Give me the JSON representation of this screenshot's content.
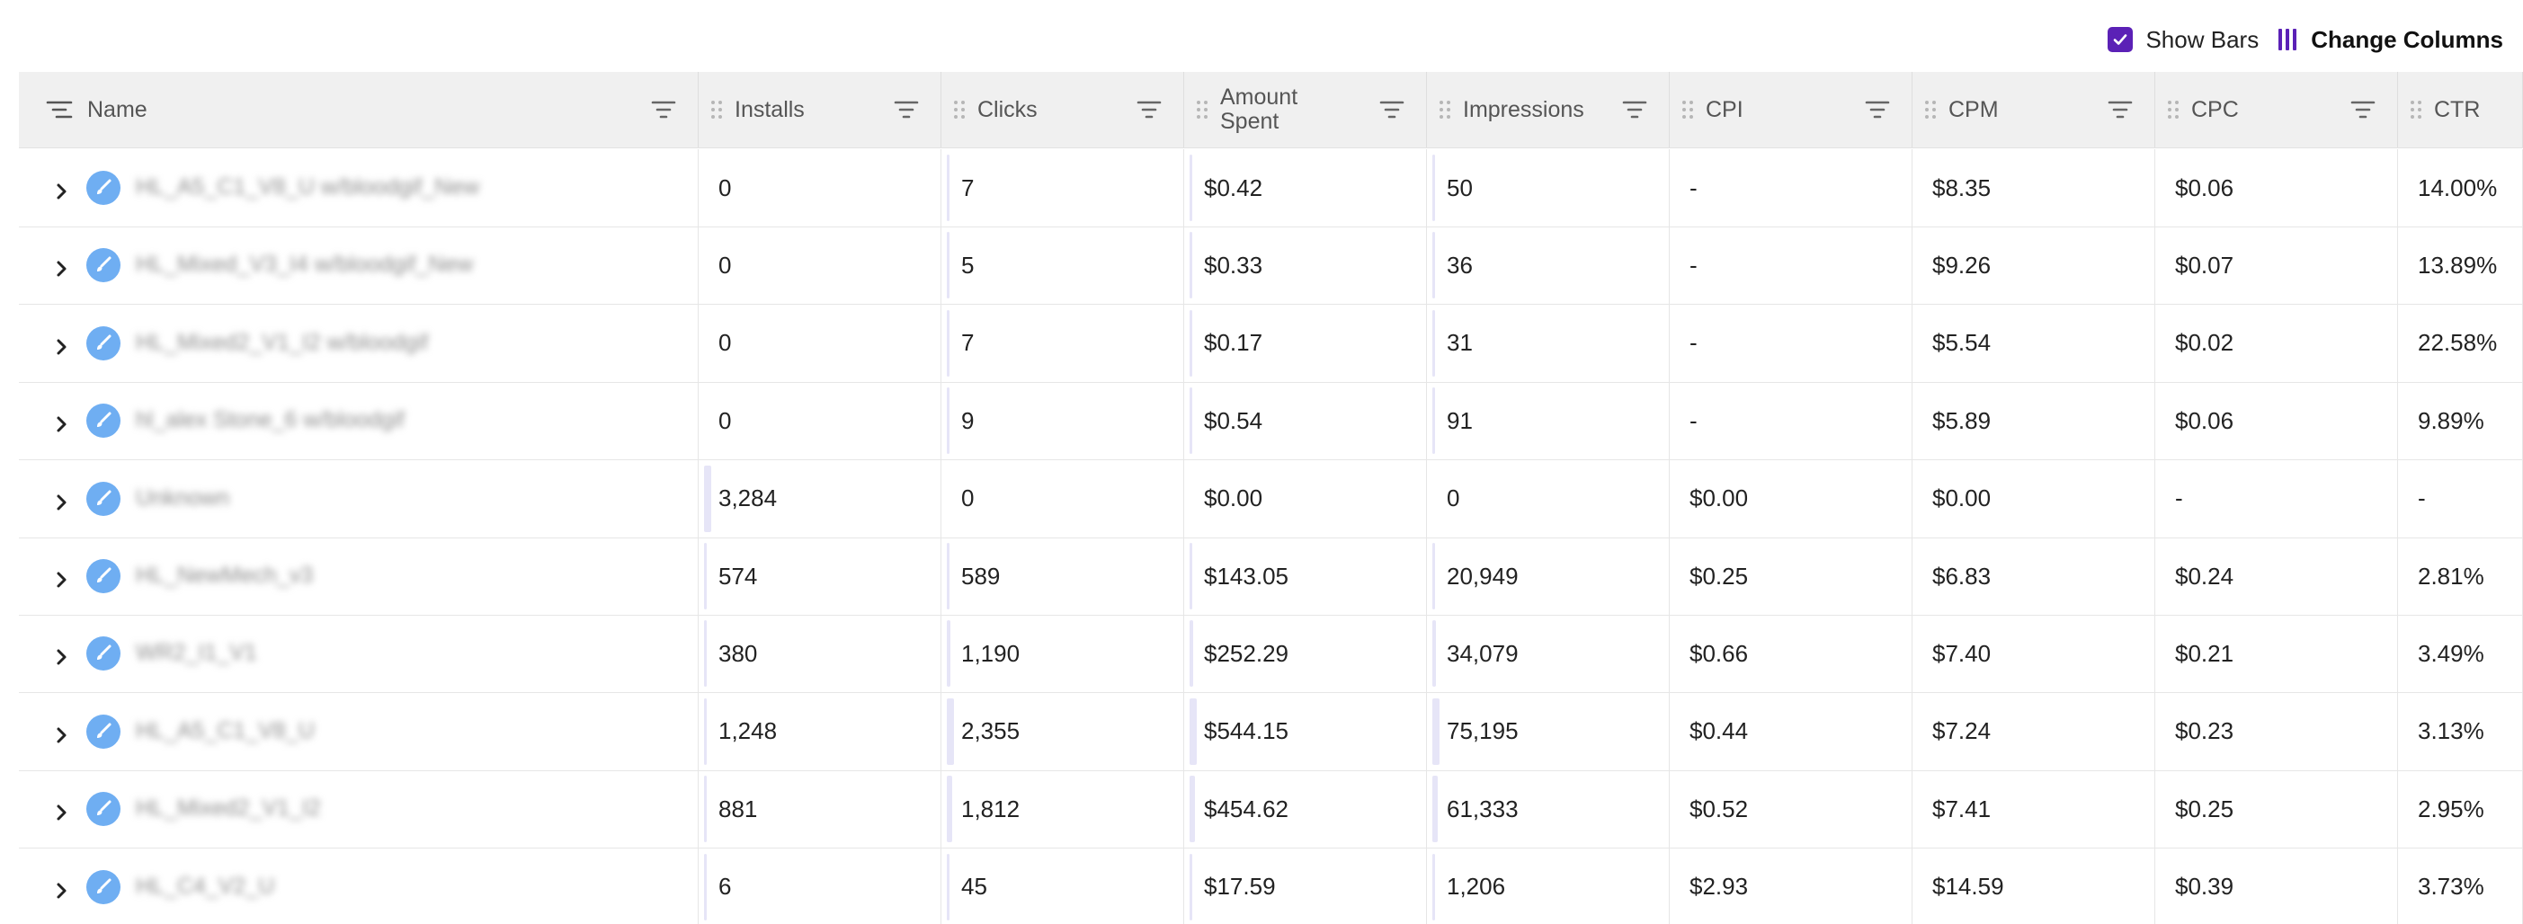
{
  "toolbar": {
    "show_bars_label": "Show Bars",
    "show_bars_checked": true,
    "change_columns_label": "Change Columns",
    "accent_color": "#5b21b6"
  },
  "columns": [
    {
      "key": "name",
      "label": "Name"
    },
    {
      "key": "installs",
      "label": "Installs"
    },
    {
      "key": "clicks",
      "label": "Clicks"
    },
    {
      "key": "amount_spent",
      "label": "Amount\nSpent"
    },
    {
      "key": "impressions",
      "label": "Impressions"
    },
    {
      "key": "cpi",
      "label": "CPI"
    },
    {
      "key": "cpm",
      "label": "CPM"
    },
    {
      "key": "cpc",
      "label": "CPC"
    },
    {
      "key": "ctr",
      "label": "CTR"
    }
  ],
  "rows": [
    {
      "name": "HL_A5_C1_V8_U w/bloodgif_New",
      "installs": "0",
      "clicks": "7",
      "amount_spent": "$0.42",
      "impressions": "50",
      "cpi": "-",
      "cpm": "$8.35",
      "cpc": "$0.06",
      "ctr": "14.00%"
    },
    {
      "name": "HL_Mixed_V3_I4 w/bloodgif_New",
      "installs": "0",
      "clicks": "5",
      "amount_spent": "$0.33",
      "impressions": "36",
      "cpi": "-",
      "cpm": "$9.26",
      "cpc": "$0.07",
      "ctr": "13.89%"
    },
    {
      "name": "HL_Mixed2_V1_I2 w/bloodgif",
      "installs": "0",
      "clicks": "7",
      "amount_spent": "$0.17",
      "impressions": "31",
      "cpi": "-",
      "cpm": "$5.54",
      "cpc": "$0.02",
      "ctr": "22.58%"
    },
    {
      "name": "hl_alex Stone_6 w/bloodgif",
      "installs": "0",
      "clicks": "9",
      "amount_spent": "$0.54",
      "impressions": "91",
      "cpi": "-",
      "cpm": "$5.89",
      "cpc": "$0.06",
      "ctr": "9.89%"
    },
    {
      "name": "Unknown",
      "installs": "3,284",
      "clicks": "0",
      "amount_spent": "$0.00",
      "impressions": "0",
      "cpi": "$0.00",
      "cpm": "$0.00",
      "cpc": "-",
      "ctr": "-"
    },
    {
      "name": "HL_NewMech_v3",
      "installs": "574",
      "clicks": "589",
      "amount_spent": "$143.05",
      "impressions": "20,949",
      "cpi": "$0.25",
      "cpm": "$6.83",
      "cpc": "$0.24",
      "ctr": "2.81%"
    },
    {
      "name": "WR2_I1_V1",
      "installs": "380",
      "clicks": "1,190",
      "amount_spent": "$252.29",
      "impressions": "34,079",
      "cpi": "$0.66",
      "cpm": "$7.40",
      "cpc": "$0.21",
      "ctr": "3.49%"
    },
    {
      "name": "HL_A5_C1_V8_U",
      "installs": "1,248",
      "clicks": "2,355",
      "amount_spent": "$544.15",
      "impressions": "75,195",
      "cpi": "$0.44",
      "cpm": "$7.24",
      "cpc": "$0.23",
      "ctr": "3.13%"
    },
    {
      "name": "HL_Mixed2_V1_I2",
      "installs": "881",
      "clicks": "1,812",
      "amount_spent": "$454.62",
      "impressions": "61,333",
      "cpi": "$0.52",
      "cpm": "$7.41",
      "cpc": "$0.25",
      "ctr": "2.95%"
    },
    {
      "name": "HL_C4_V2_U",
      "installs": "6",
      "clicks": "45",
      "amount_spent": "$17.59",
      "impressions": "1,206",
      "cpi": "$2.93",
      "cpm": "$14.59",
      "cpc": "$0.39",
      "ctr": "3.73%"
    }
  ],
  "bar_color": "#e6e5f7",
  "icons": {
    "name_column": "list-sort-icon",
    "drag": "drag-handle-icon",
    "filter": "filter-icon",
    "expand": "chevron-right-icon",
    "row_brand": "paintbrush-icon",
    "checkbox": "checkmark-icon",
    "change_columns": "columns-icon"
  }
}
